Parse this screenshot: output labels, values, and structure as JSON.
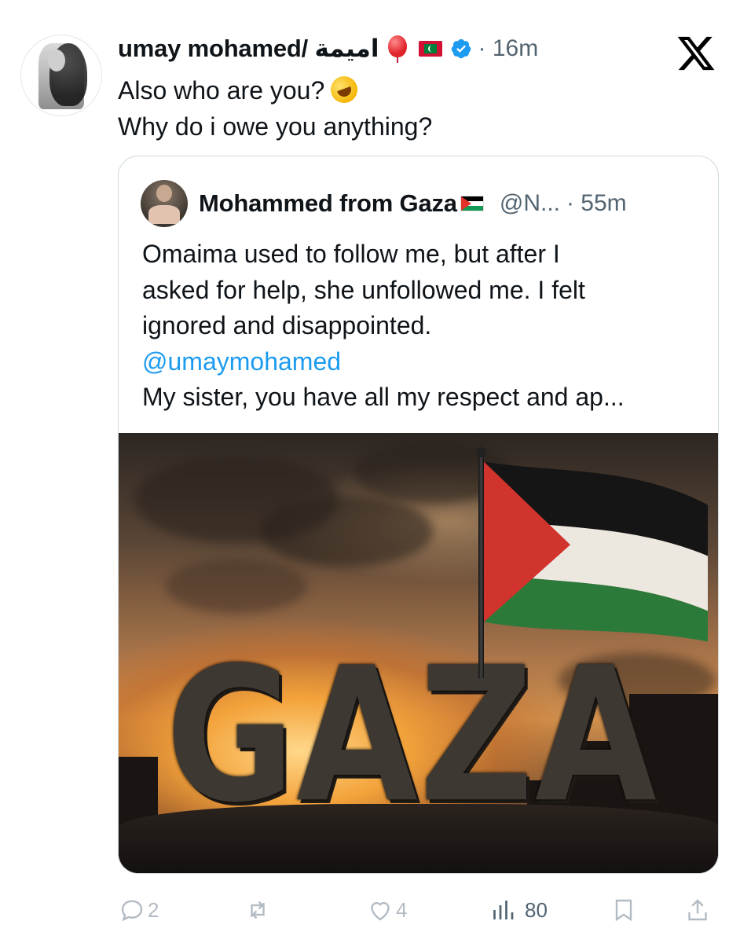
{
  "post": {
    "display_name": "umay mohamed/ اميمة",
    "time": "· 16m",
    "text_line1": "Also who are you?",
    "text_line2": "Why do i owe you anything?"
  },
  "quote": {
    "display_name": "Mohammed from Gaza",
    "handle": "@N...",
    "time": "· 55m",
    "line1": "Omaima used to follow me, but after I",
    "line2": "asked for help, she unfollowed me. I felt",
    "line3": "ignored and disappointed.",
    "mention": "@umaymohamed",
    "line5": "My sister, you have all my respect and ap...",
    "image_text": "GAZA"
  },
  "actions": {
    "replies": "2",
    "reposts": "",
    "likes": "4",
    "views": "80"
  },
  "icons": {
    "logo": "x-logo-icon",
    "verified": "verified-badge-icon",
    "reply": "reply-icon",
    "repost": "repost-icon",
    "like": "heart-icon",
    "views": "views-chart-icon",
    "bookmark": "bookmark-icon",
    "share": "share-icon"
  },
  "colors": {
    "text": "#0f1419",
    "muted": "#536471",
    "link": "#1d9bf0",
    "border": "#cfd9de"
  }
}
